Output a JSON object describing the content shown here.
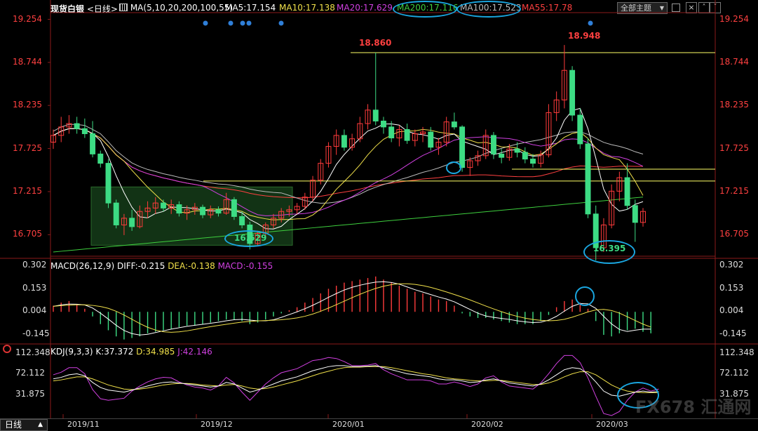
{
  "header": {
    "symbol": "现货白银",
    "period": "<日线>",
    "ma_params": "MA(5,10,20,200,100,55)",
    "ma5": "MA5:17.154",
    "ma10": "MA10:17.138",
    "ma20": "MA20:17.629",
    "ma200": "MA200:17.116",
    "ma100": "MA100:17.523",
    "ma55": "MA55:17.78",
    "theme_button": "全部主题",
    "theme_arrow": "▼"
  },
  "colors": {
    "up": "#ff3b3b",
    "down": "#3ddc84",
    "ma5": "#ffffff",
    "ma10": "#f0e04a",
    "ma20": "#d040e0",
    "ma200": "#3ecf3e",
    "ma100": "#bbbbbb",
    "ma55": "#ff4040",
    "hline": "#ffff66",
    "ring": "#1aa6e0"
  },
  "price_axis": {
    "ticks": [
      "19.254",
      "18.744",
      "18.235",
      "17.725",
      "17.215",
      "16.705"
    ]
  },
  "macd": {
    "label": "MACD(26,12,9)",
    "diff": "DIFF:-0.215",
    "dea": "DEA:-0.138",
    "macd": "MACD:-0.155",
    "ticks": [
      "0.302",
      "0.153",
      "0.004",
      "-0.145"
    ]
  },
  "kdj": {
    "label": "KDJ(9,3,3)",
    "k": "K:37.372",
    "d": "D:34.985",
    "j": "J:42.146",
    "ticks": [
      "112.348",
      "72.112",
      "31.875"
    ]
  },
  "annotations": {
    "high_1": "18.860",
    "high_2": "18.948",
    "low_1": "16.529",
    "low_2": "16.395"
  },
  "footer": {
    "period_button": "日线",
    "period_arrow": "▲",
    "dates": [
      "2019/11",
      "2019/12",
      "2020/01",
      "2020/02",
      "2020/03"
    ]
  },
  "watermark": "FX678 汇通网",
  "chart_data": {
    "type": "candlestick",
    "title": "现货白银",
    "ylim": [
      16.45,
      19.3
    ],
    "candles": [
      {
        "o": 17.8,
        "h": 17.95,
        "l": 17.72,
        "c": 17.88
      },
      {
        "o": 17.88,
        "h": 18.1,
        "l": 17.8,
        "c": 17.98
      },
      {
        "o": 17.98,
        "h": 18.12,
        "l": 17.9,
        "c": 18.02
      },
      {
        "o": 18.02,
        "h": 18.1,
        "l": 17.9,
        "c": 17.96
      },
      {
        "o": 17.96,
        "h": 18.08,
        "l": 17.85,
        "c": 17.9
      },
      {
        "o": 17.9,
        "h": 18.05,
        "l": 17.62,
        "c": 17.66
      },
      {
        "o": 17.66,
        "h": 17.7,
        "l": 17.5,
        "c": 17.55
      },
      {
        "o": 17.55,
        "h": 17.6,
        "l": 17.02,
        "c": 17.08
      },
      {
        "o": 17.08,
        "h": 17.12,
        "l": 16.78,
        "c": 16.82
      },
      {
        "o": 16.82,
        "h": 16.95,
        "l": 16.7,
        "c": 16.9
      },
      {
        "o": 16.9,
        "h": 17.0,
        "l": 16.75,
        "c": 16.8
      },
      {
        "o": 16.8,
        "h": 17.05,
        "l": 16.78,
        "c": 16.98
      },
      {
        "o": 16.98,
        "h": 17.1,
        "l": 16.9,
        "c": 17.02
      },
      {
        "o": 17.02,
        "h": 17.15,
        "l": 16.95,
        "c": 17.08
      },
      {
        "o": 17.08,
        "h": 17.12,
        "l": 16.98,
        "c": 17.02
      },
      {
        "o": 17.02,
        "h": 17.12,
        "l": 16.95,
        "c": 17.06
      },
      {
        "o": 17.06,
        "h": 17.1,
        "l": 16.92,
        "c": 16.96
      },
      {
        "o": 16.96,
        "h": 17.05,
        "l": 16.88,
        "c": 17.0
      },
      {
        "o": 17.0,
        "h": 17.08,
        "l": 16.94,
        "c": 17.03
      },
      {
        "o": 17.03,
        "h": 17.06,
        "l": 16.9,
        "c": 16.94
      },
      {
        "o": 16.94,
        "h": 17.05,
        "l": 16.9,
        "c": 17.0
      },
      {
        "o": 17.0,
        "h": 17.04,
        "l": 16.92,
        "c": 16.96
      },
      {
        "o": 16.96,
        "h": 17.2,
        "l": 16.94,
        "c": 17.12
      },
      {
        "o": 17.12,
        "h": 17.15,
        "l": 16.88,
        "c": 16.92
      },
      {
        "o": 16.92,
        "h": 16.98,
        "l": 16.78,
        "c": 16.82
      },
      {
        "o": 16.82,
        "h": 16.86,
        "l": 16.53,
        "c": 16.6
      },
      {
        "o": 16.6,
        "h": 16.75,
        "l": 16.58,
        "c": 16.72
      },
      {
        "o": 16.72,
        "h": 16.85,
        "l": 16.68,
        "c": 16.82
      },
      {
        "o": 16.82,
        "h": 16.95,
        "l": 16.78,
        "c": 16.9
      },
      {
        "o": 16.9,
        "h": 17.02,
        "l": 16.85,
        "c": 16.98
      },
      {
        "o": 16.98,
        "h": 17.05,
        "l": 16.92,
        "c": 17.0
      },
      {
        "o": 17.0,
        "h": 17.08,
        "l": 16.95,
        "c": 17.04
      },
      {
        "o": 17.04,
        "h": 17.2,
        "l": 17.0,
        "c": 17.15
      },
      {
        "o": 17.15,
        "h": 17.4,
        "l": 17.1,
        "c": 17.35
      },
      {
        "o": 17.35,
        "h": 17.6,
        "l": 17.3,
        "c": 17.55
      },
      {
        "o": 17.55,
        "h": 17.8,
        "l": 17.5,
        "c": 17.75
      },
      {
        "o": 17.75,
        "h": 17.95,
        "l": 17.65,
        "c": 17.88
      },
      {
        "o": 17.88,
        "h": 17.95,
        "l": 17.7,
        "c": 17.74
      },
      {
        "o": 17.74,
        "h": 17.9,
        "l": 17.7,
        "c": 17.84
      },
      {
        "o": 17.84,
        "h": 18.1,
        "l": 17.8,
        "c": 18.02
      },
      {
        "o": 18.02,
        "h": 18.25,
        "l": 17.95,
        "c": 18.18
      },
      {
        "o": 18.18,
        "h": 18.86,
        "l": 18.0,
        "c": 18.05
      },
      {
        "o": 18.05,
        "h": 18.1,
        "l": 17.9,
        "c": 17.98
      },
      {
        "o": 17.98,
        "h": 18.05,
        "l": 17.8,
        "c": 17.85
      },
      {
        "o": 17.85,
        "h": 18.0,
        "l": 17.75,
        "c": 17.95
      },
      {
        "o": 17.95,
        "h": 18.02,
        "l": 17.78,
        "c": 17.82
      },
      {
        "o": 17.82,
        "h": 17.95,
        "l": 17.75,
        "c": 17.9
      },
      {
        "o": 17.9,
        "h": 17.98,
        "l": 17.8,
        "c": 17.92
      },
      {
        "o": 17.92,
        "h": 17.98,
        "l": 17.7,
        "c": 17.74
      },
      {
        "o": 17.74,
        "h": 17.85,
        "l": 17.65,
        "c": 17.8
      },
      {
        "o": 17.8,
        "h": 18.1,
        "l": 17.75,
        "c": 18.04
      },
      {
        "o": 18.04,
        "h": 18.15,
        "l": 17.95,
        "c": 17.98
      },
      {
        "o": 17.98,
        "h": 18.0,
        "l": 17.45,
        "c": 17.5
      },
      {
        "o": 17.5,
        "h": 17.62,
        "l": 17.4,
        "c": 17.58
      },
      {
        "o": 17.58,
        "h": 17.7,
        "l": 17.52,
        "c": 17.64
      },
      {
        "o": 17.64,
        "h": 17.95,
        "l": 17.6,
        "c": 17.88
      },
      {
        "o": 17.88,
        "h": 17.92,
        "l": 17.6,
        "c": 17.66
      },
      {
        "o": 17.66,
        "h": 17.72,
        "l": 17.55,
        "c": 17.62
      },
      {
        "o": 17.62,
        "h": 17.78,
        "l": 17.58,
        "c": 17.72
      },
      {
        "o": 17.72,
        "h": 17.8,
        "l": 17.62,
        "c": 17.68
      },
      {
        "o": 17.68,
        "h": 17.74,
        "l": 17.55,
        "c": 17.6
      },
      {
        "o": 17.6,
        "h": 17.66,
        "l": 17.5,
        "c": 17.55
      },
      {
        "o": 17.55,
        "h": 17.7,
        "l": 17.5,
        "c": 17.65
      },
      {
        "o": 17.65,
        "h": 18.25,
        "l": 17.62,
        "c": 18.15
      },
      {
        "o": 18.15,
        "h": 18.4,
        "l": 18.05,
        "c": 18.3
      },
      {
        "o": 18.3,
        "h": 18.95,
        "l": 18.2,
        "c": 18.65
      },
      {
        "o": 18.65,
        "h": 18.7,
        "l": 18.05,
        "c": 18.12
      },
      {
        "o": 18.12,
        "h": 18.2,
        "l": 17.72,
        "c": 17.78
      },
      {
        "o": 17.78,
        "h": 17.85,
        "l": 16.9,
        "c": 16.95
      },
      {
        "o": 16.95,
        "h": 17.05,
        "l": 16.4,
        "c": 16.55
      },
      {
        "o": 16.55,
        "h": 16.9,
        "l": 16.5,
        "c": 16.82
      },
      {
        "o": 16.82,
        "h": 17.3,
        "l": 16.78,
        "c": 17.22
      },
      {
        "o": 17.22,
        "h": 17.45,
        "l": 17.1,
        "c": 17.38
      },
      {
        "o": 17.38,
        "h": 17.55,
        "l": 17.0,
        "c": 17.05
      },
      {
        "o": 17.05,
        "h": 17.12,
        "l": 16.62,
        "c": 16.85
      },
      {
        "o": 16.85,
        "h": 17.02,
        "l": 16.8,
        "c": 16.98
      }
    ],
    "hlines": [
      18.86,
      17.48,
      17.34
    ],
    "macd_hist": [
      0.04,
      0.06,
      0.07,
      0.05,
      0.02,
      -0.03,
      -0.08,
      -0.12,
      -0.16,
      -0.18,
      -0.17,
      -0.16,
      -0.14,
      -0.13,
      -0.12,
      -0.11,
      -0.1,
      -0.09,
      -0.09,
      -0.08,
      -0.07,
      -0.06,
      -0.05,
      -0.05,
      -0.06,
      -0.08,
      -0.07,
      -0.05,
      -0.03,
      -0.01,
      0.01,
      0.03,
      0.06,
      0.09,
      0.12,
      0.15,
      0.17,
      0.19,
      0.2,
      0.21,
      0.22,
      0.23,
      0.21,
      0.19,
      0.17,
      0.15,
      0.13,
      0.12,
      0.1,
      0.08,
      0.07,
      0.04,
      -0.01,
      -0.03,
      -0.04,
      -0.04,
      -0.05,
      -0.06,
      -0.07,
      -0.08,
      -0.08,
      -0.08,
      -0.06,
      -0.02,
      0.03,
      0.07,
      0.08,
      0.06,
      0.02,
      -0.06,
      -0.15,
      -0.16,
      -0.14,
      -0.12,
      -0.11,
      -0.13,
      -0.14
    ],
    "kdj_k": [
      62,
      65,
      70,
      72,
      68,
      55,
      45,
      40,
      38,
      36,
      40,
      44,
      48,
      52,
      55,
      56,
      54,
      52,
      50,
      48,
      46,
      48,
      55,
      52,
      44,
      36,
      40,
      46,
      52,
      58,
      62,
      66,
      72,
      78,
      82,
      86,
      88,
      88,
      86,
      86,
      87,
      88,
      84,
      80,
      76,
      72,
      70,
      68,
      66,
      62,
      60,
      60,
      58,
      55,
      56,
      60,
      62,
      58,
      54,
      52,
      50,
      48,
      52,
      60,
      70,
      80,
      84,
      82,
      72,
      56,
      38,
      30,
      28,
      32,
      36,
      38,
      36,
      37
    ],
    "kdj_d": [
      58,
      60,
      63,
      66,
      66,
      62,
      56,
      50,
      46,
      42,
      41,
      42,
      44,
      47,
      50,
      52,
      53,
      53,
      52,
      50,
      49,
      48,
      50,
      51,
      48,
      44,
      42,
      43,
      46,
      50,
      54,
      58,
      63,
      68,
      73,
      77,
      81,
      84,
      85,
      85,
      86,
      86,
      86,
      84,
      81,
      78,
      75,
      72,
      70,
      67,
      64,
      62,
      61,
      59,
      58,
      58,
      59,
      59,
      57,
      55,
      53,
      51,
      51,
      54,
      59,
      66,
      72,
      76,
      76,
      70,
      60,
      50,
      43,
      38,
      36,
      35,
      35,
      35
    ],
    "kdj_j": [
      70,
      75,
      84,
      84,
      72,
      41,
      23,
      20,
      22,
      24,
      38,
      48,
      56,
      62,
      65,
      64,
      56,
      50,
      46,
      44,
      40,
      48,
      65,
      54,
      36,
      20,
      36,
      52,
      64,
      74,
      78,
      82,
      90,
      98,
      100,
      104,
      102,
      96,
      88,
      88,
      89,
      92,
      80,
      72,
      66,
      60,
      60,
      60,
      58,
      52,
      52,
      56,
      52,
      47,
      52,
      64,
      68,
      56,
      48,
      46,
      44,
      42,
      54,
      72,
      92,
      108,
      108,
      94,
      64,
      28,
      -6,
      -10,
      -2,
      20,
      36,
      44,
      38,
      42
    ]
  }
}
